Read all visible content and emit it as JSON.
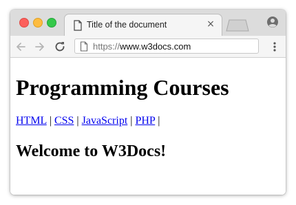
{
  "tab": {
    "title": "Title of the document",
    "close_symbol": "×"
  },
  "omnibox": {
    "scheme": "https://",
    "host": "www.w3docs.com"
  },
  "page": {
    "heading": "Programming Courses",
    "nav_links": [
      {
        "label": "HTML"
      },
      {
        "label": "CSS"
      },
      {
        "label": "JavaScript"
      },
      {
        "label": "PHP"
      }
    ],
    "separator": "|",
    "subheading": "Welcome to W3Docs!"
  },
  "icons": {
    "tab": "document-icon",
    "new_tab": "new-tab-icon",
    "profile": "profile-icon",
    "back": "back-arrow-icon",
    "forward": "forward-arrow-icon",
    "reload": "reload-icon",
    "omnibox": "page-icon",
    "menu": "kebab-menu-icon"
  },
  "colors": {
    "link": "#0000ee",
    "titlebar": "#dcdcdc",
    "traffic_red": "#fc605c",
    "traffic_yellow": "#fdbc40",
    "traffic_green": "#34c84a"
  }
}
